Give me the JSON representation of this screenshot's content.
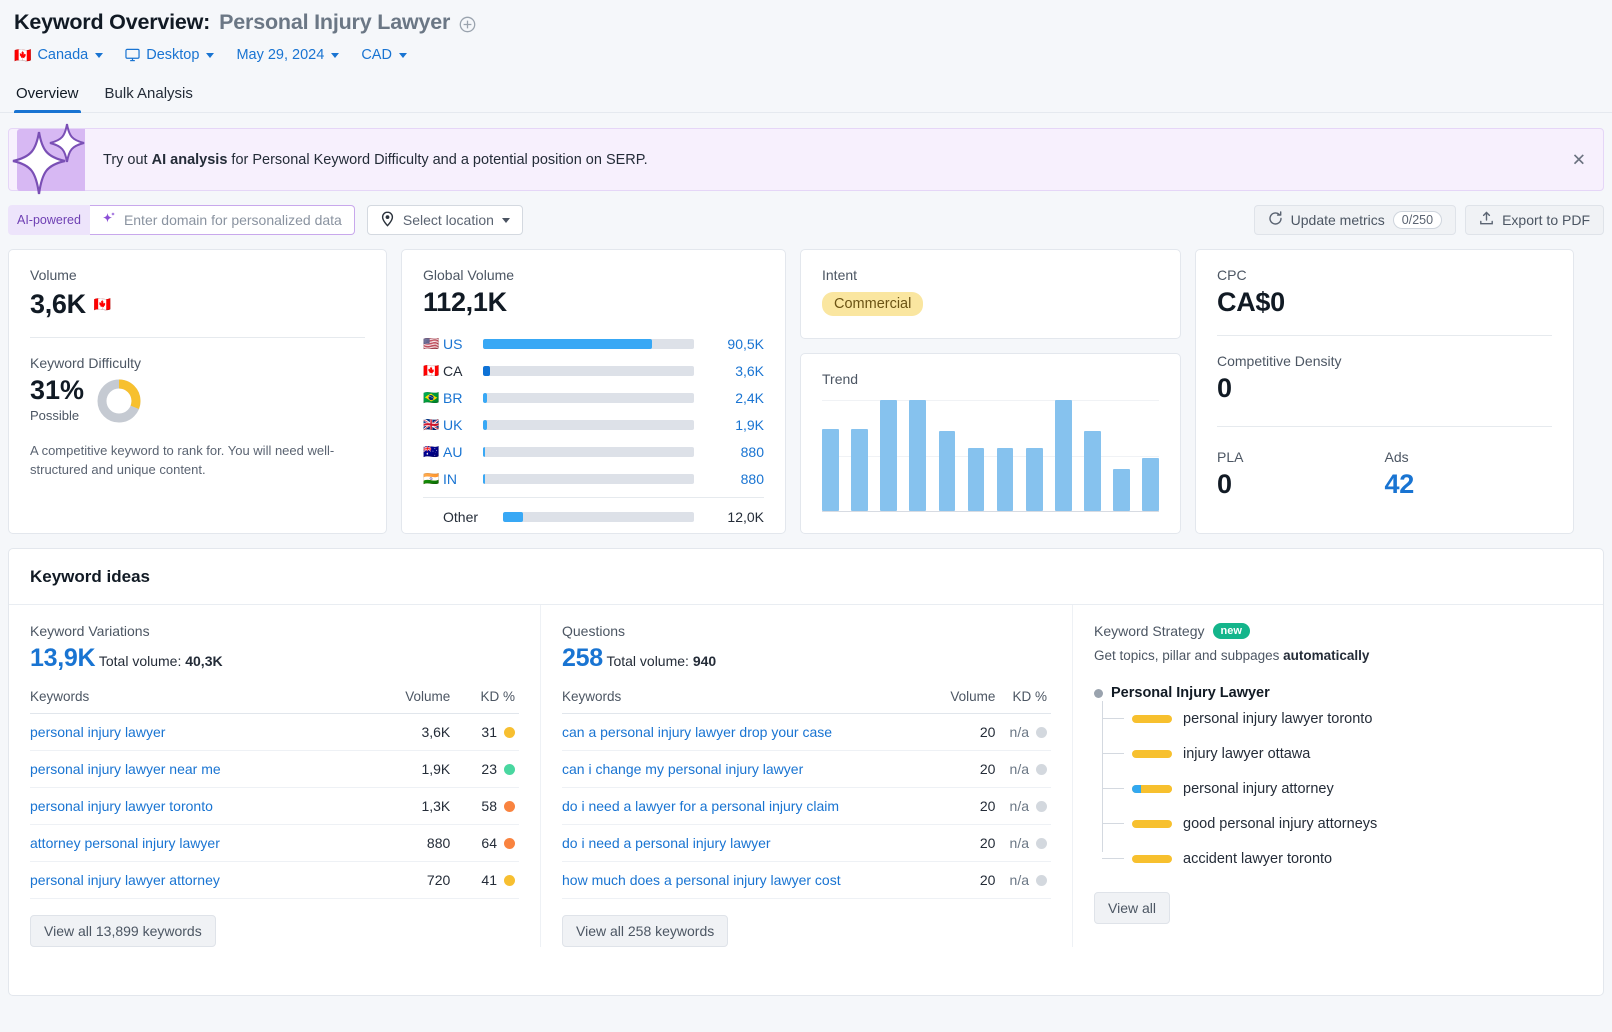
{
  "header": {
    "title_prefix": "Keyword Overview:",
    "keyword": "Personal Injury Lawyer",
    "selectors": {
      "country": "Canada",
      "country_flag": "🇨🇦",
      "device": "Desktop",
      "date": "May 29, 2024",
      "currency": "CAD"
    },
    "tabs": [
      {
        "label": "Overview",
        "active": true
      },
      {
        "label": "Bulk Analysis",
        "active": false
      }
    ]
  },
  "ai_banner": {
    "text_before": "Try out ",
    "highlight": "AI analysis",
    "text_after": " for Personal Keyword Difficulty and a potential position on SERP.",
    "close_label": "✕"
  },
  "toolbar": {
    "ai_pill": "AI-powered",
    "domain_placeholder": "Enter domain for personalized data",
    "location_label": "Select location",
    "update_metrics_label": "Update metrics",
    "update_metrics_count": "0/250",
    "export_label": "Export to PDF"
  },
  "volume_card": {
    "label": "Volume",
    "value": "3,6K",
    "flag": "🇨🇦",
    "kd_label": "Keyword Difficulty",
    "kd_value": "31%",
    "kd_percent": 31,
    "kd_status": "Possible",
    "kd_description": "A competitive keyword to rank for. You will need well-structured and unique content.",
    "kd_color": "#f7c02e"
  },
  "global_volume": {
    "label": "Global Volume",
    "value": "112,1K",
    "rows": [
      {
        "flag": "🇺🇸",
        "code": "US",
        "value": "90,5K",
        "pct": 80,
        "current": false
      },
      {
        "flag": "🇨🇦",
        "code": "CA",
        "value": "3,6K",
        "pct": 3.2,
        "current": true
      },
      {
        "flag": "🇧🇷",
        "code": "BR",
        "value": "2,4K",
        "pct": 2.1,
        "current": false
      },
      {
        "flag": "🇬🇧",
        "code": "UK",
        "value": "1,9K",
        "pct": 1.7,
        "current": false
      },
      {
        "flag": "🇦🇺",
        "code": "AU",
        "value": "880",
        "pct": 0.9,
        "current": false
      },
      {
        "flag": "🇮🇳",
        "code": "IN",
        "value": "880",
        "pct": 0.9,
        "current": false
      }
    ],
    "other": {
      "code": "Other",
      "value": "12,0K",
      "pct": 10.6
    }
  },
  "intent": {
    "label": "Intent",
    "value": "Commercial"
  },
  "trend": {
    "label": "Trend"
  },
  "cpc_card": {
    "label": "CPC",
    "value": "CA$0",
    "density_label": "Competitive Density",
    "density_value": "0",
    "pla_label": "PLA",
    "pla_value": "0",
    "ads_label": "Ads",
    "ads_value": "42"
  },
  "ideas": {
    "title": "Keyword ideas",
    "variations": {
      "heading": "Keyword Variations",
      "count": "13,9K",
      "total_label": "Total volume:",
      "total_value": "40,3K",
      "columns": [
        "Keywords",
        "Volume",
        "KD %"
      ],
      "rows": [
        {
          "keyword": "personal injury lawyer",
          "volume": "3,6K",
          "kd": "31",
          "kd_color": "#f7bf30"
        },
        {
          "keyword": "personal injury lawyer near me",
          "volume": "1,9K",
          "kd": "23",
          "kd_color": "#49d7a0"
        },
        {
          "keyword": "personal injury lawyer toronto",
          "volume": "1,3K",
          "kd": "58",
          "kd_color": "#f9833f"
        },
        {
          "keyword": "attorney personal injury lawyer",
          "volume": "880",
          "kd": "64",
          "kd_color": "#f9833f"
        },
        {
          "keyword": "personal injury lawyer attorney",
          "volume": "720",
          "kd": "41",
          "kd_color": "#f7bf30"
        }
      ],
      "view_all": "View all 13,899 keywords"
    },
    "questions": {
      "heading": "Questions",
      "count": "258",
      "total_label": "Total volume:",
      "total_value": "940",
      "columns": [
        "Keywords",
        "Volume",
        "KD %"
      ],
      "rows": [
        {
          "keyword": "can a personal injury lawyer drop your case",
          "volume": "20",
          "kd": "n/a",
          "kd_color": "#d3d8de"
        },
        {
          "keyword": "can i change my personal injury lawyer",
          "volume": "20",
          "kd": "n/a",
          "kd_color": "#d3d8de"
        },
        {
          "keyword": "do i need a lawyer for a personal injury claim",
          "volume": "20",
          "kd": "n/a",
          "kd_color": "#d3d8de"
        },
        {
          "keyword": "do i need a personal injury lawyer",
          "volume": "20",
          "kd": "n/a",
          "kd_color": "#d3d8de"
        },
        {
          "keyword": "how much does a personal injury lawyer cost",
          "volume": "20",
          "kd": "n/a",
          "kd_color": "#d3d8de"
        }
      ],
      "view_all": "View all 258 keywords"
    },
    "strategy": {
      "heading": "Keyword Strategy",
      "badge": "new",
      "subtitle_before": "Get topics, pillar and subpages ",
      "subtitle_bold": "automatically",
      "root": "Personal Injury Lawyer",
      "items": [
        {
          "label": "personal injury lawyer toronto",
          "has_blue": false
        },
        {
          "label": "injury lawyer ottawa",
          "has_blue": false
        },
        {
          "label": "personal injury attorney",
          "has_blue": true
        },
        {
          "label": "good personal injury attorneys",
          "has_blue": false
        },
        {
          "label": "accident lawyer toronto",
          "has_blue": false
        }
      ],
      "view_all": "View all"
    }
  },
  "chart_data": [
    {
      "type": "bar",
      "title": "Trend",
      "categories": [
        "1",
        "2",
        "3",
        "4",
        "5",
        "6",
        "7",
        "8",
        "9",
        "10",
        "11",
        "12"
      ],
      "values": [
        74,
        74,
        100,
        100,
        72,
        57,
        57,
        57,
        100,
        72,
        38,
        48
      ],
      "xlabel": "",
      "ylabel": "",
      "ylim": [
        0,
        100
      ],
      "grid": true,
      "color": "#86c2ee"
    },
    {
      "type": "bar",
      "title": "Global Volume",
      "categories": [
        "US",
        "CA",
        "BR",
        "UK",
        "AU",
        "IN",
        "Other"
      ],
      "values": [
        90500,
        3600,
        2400,
        1900,
        880,
        880,
        12000
      ],
      "tick_labels": [
        "90,5K",
        "3,6K",
        "2,4K",
        "1,9K",
        "880",
        "880",
        "12,0K"
      ],
      "xlabel": "",
      "ylabel": "",
      "grid": false,
      "orientation": "horizontal",
      "color": "#38a8f5"
    },
    {
      "type": "pie",
      "title": "Keyword Difficulty",
      "categories": [
        "Difficulty",
        "Remaining"
      ],
      "values": [
        31,
        69
      ],
      "colors": [
        "#f7c02e",
        "#c5cad2"
      ]
    }
  ]
}
